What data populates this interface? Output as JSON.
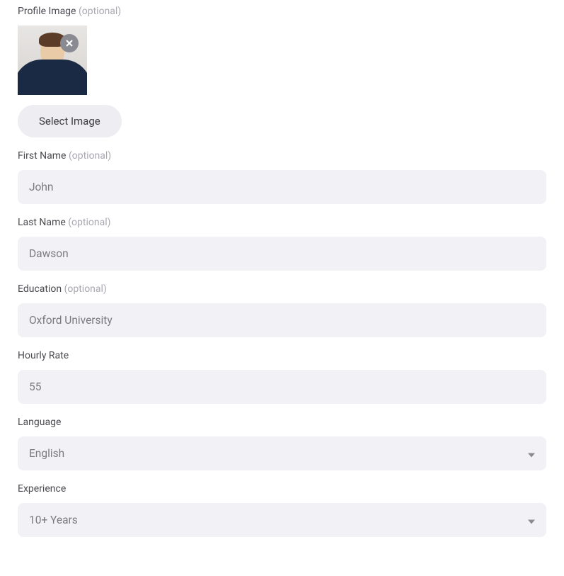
{
  "profileImage": {
    "label": "Profile Image",
    "optional": "(optional)",
    "selectButton": "Select Image"
  },
  "firstName": {
    "label": "First Name",
    "optional": "(optional)",
    "value": "John"
  },
  "lastName": {
    "label": "Last Name",
    "optional": "(optional)",
    "value": "Dawson"
  },
  "education": {
    "label": "Education",
    "optional": "(optional)",
    "value": "Oxford University"
  },
  "hourlyRate": {
    "label": "Hourly Rate",
    "value": "55"
  },
  "language": {
    "label": "Language",
    "value": "English"
  },
  "experience": {
    "label": "Experience",
    "value": "10+ Years"
  }
}
